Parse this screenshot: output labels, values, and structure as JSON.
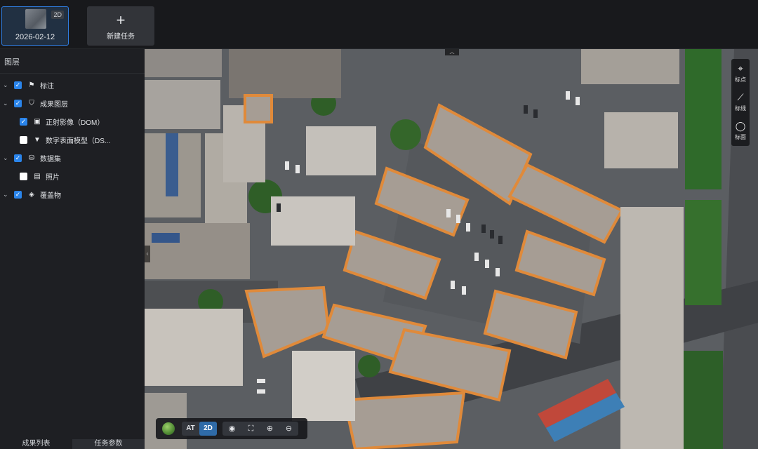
{
  "tasks": {
    "items": [
      {
        "date": "2026-02-12",
        "badge": "2D"
      }
    ],
    "new_task_label": "新建任务"
  },
  "layers_panel": {
    "title": "图层",
    "items": [
      {
        "label": "标注",
        "checked": true,
        "icon": "flag-icon"
      },
      {
        "label": "成果图层",
        "checked": true,
        "icon": "shield-icon"
      },
      {
        "label": "正射影像（DOM）",
        "checked": true,
        "icon": "image-icon"
      },
      {
        "label": "数字表面模型（DS...",
        "checked": false,
        "icon": "terrain-icon"
      },
      {
        "label": "数据集",
        "checked": true,
        "icon": "dataset-icon"
      },
      {
        "label": "照片",
        "checked": false,
        "icon": "photo-icon"
      },
      {
        "label": "覆盖物",
        "checked": true,
        "icon": "layers-icon"
      }
    ]
  },
  "bottom_tabs": [
    "成果列表",
    "任务参数"
  ],
  "map_tools": [
    {
      "label": "标点",
      "icon": "pin-icon"
    },
    {
      "label": "标线",
      "icon": "line-icon"
    },
    {
      "label": "标面",
      "icon": "polygon-icon"
    }
  ],
  "map_toolbar": {
    "modes": [
      "AT",
      "2D"
    ],
    "active_mode": "2D",
    "tools": [
      "camera-icon",
      "fit-extent-icon",
      "zoom-in-icon",
      "zoom-out-icon"
    ]
  },
  "colors": {
    "accent": "#2a84ea",
    "panel_bg": "#1e1f23",
    "building_outline": "#e08a3a"
  }
}
